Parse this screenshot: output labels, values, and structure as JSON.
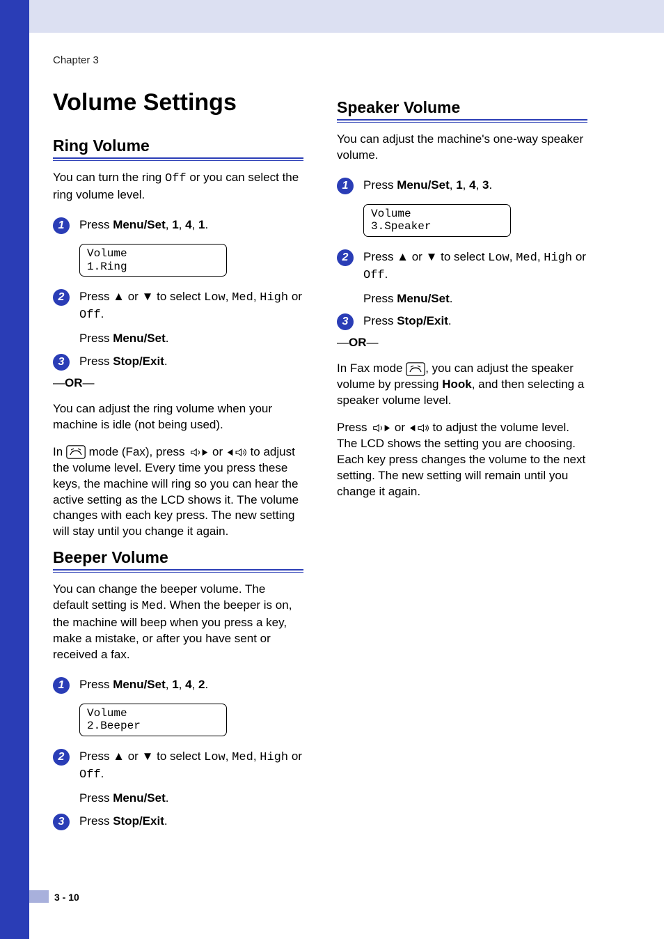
{
  "chapter": "Chapter 3",
  "page_title": "Volume Settings",
  "footer": "3 - 10",
  "left": {
    "ring": {
      "heading": "Ring Volume",
      "intro_a": "You can turn the ring ",
      "intro_off": "Off",
      "intro_b": " or you can select the ring volume level.",
      "step1": {
        "num": "1",
        "a": "Press ",
        "b": "Menu/Set",
        "c": ", ",
        "d": "1",
        "e": ", ",
        "f": "4",
        "g": ", ",
        "h": "1",
        "i": "."
      },
      "lcd": "Volume\n1.Ring",
      "step2": {
        "num": "2",
        "a": "Press ▲ or ▼ to select ",
        "low": "Low",
        "sep1": ", ",
        "med": "Med",
        "sep2": ", ",
        "high": "High",
        "b": " or ",
        "off": "Off",
        "dot": ".",
        "press": "Press ",
        "ms": "Menu/Set",
        "dot2": "."
      },
      "step3": {
        "num": "3",
        "a": "Press ",
        "se": "Stop/Exit",
        "dot": "."
      },
      "or": "—OR—",
      "para1": "You can adjust the ring volume when your machine is idle (not being used).",
      "para2_a": "In ",
      "para2_b": " mode (Fax), press ",
      "para2_c": " or ",
      "para2_d": " to adjust the volume level. Every time you press these keys, the machine will ring so you can hear the active setting as the LCD shows it. The volume changes with each key press. The new setting will stay until you change it again."
    },
    "beeper": {
      "heading": "Beeper Volume",
      "intro_a": "You can change the beeper volume. The default setting is ",
      "intro_med": "Med",
      "intro_b": ". When the beeper is on, the machine will beep when you press a key, make a mistake, or after you have sent or received a fax.",
      "step1": {
        "num": "1",
        "a": "Press ",
        "b": "Menu/Set",
        "c": ", ",
        "d": "1",
        "e": ", ",
        "f": "4",
        "g": ", ",
        "h": "2",
        "i": "."
      },
      "lcd": "Volume\n2.Beeper",
      "step2": {
        "num": "2",
        "a": "Press ▲ or ▼ to select ",
        "low": "Low",
        "sep1": ", ",
        "med": "Med",
        "sep2": ", ",
        "high": "High",
        "b": " or ",
        "off": "Off",
        "dot": ".",
        "press": "Press ",
        "ms": "Menu/Set",
        "dot2": "."
      },
      "step3": {
        "num": "3",
        "a": "Press ",
        "se": "Stop/Exit",
        "dot": "."
      }
    }
  },
  "right": {
    "speaker": {
      "heading": "Speaker Volume",
      "intro": "You can adjust the machine's one-way speaker volume.",
      "step1": {
        "num": "1",
        "a": "Press ",
        "b": "Menu/Set",
        "c": ", ",
        "d": "1",
        "e": ", ",
        "f": "4",
        "g": ", ",
        "h": "3",
        "i": "."
      },
      "lcd": "Volume\n3.Speaker",
      "step2": {
        "num": "2",
        "a": "Press ▲ or ▼ to select ",
        "low": "Low",
        "sep1": ", ",
        "med": "Med",
        "sep2": ", ",
        "high": "High",
        "b": " or ",
        "off": "Off",
        "dot": ".",
        "press": "Press ",
        "ms": "Menu/Set",
        "dot2": "."
      },
      "step3": {
        "num": "3",
        "a": "Press ",
        "se": "Stop/Exit",
        "dot": "."
      },
      "or": "—OR—",
      "para1_a": "In Fax mode ",
      "para1_b": ", you can adjust the speaker volume by pressing ",
      "hook": "Hook",
      "para1_c": ", and then selecting a speaker volume level.",
      "para2_a": "Press ",
      "para2_b": " or ",
      "para2_c": " to adjust the volume level. The LCD shows the setting you are choosing. Each key press changes the volume to the next setting. The new setting will remain until you change it again."
    }
  }
}
